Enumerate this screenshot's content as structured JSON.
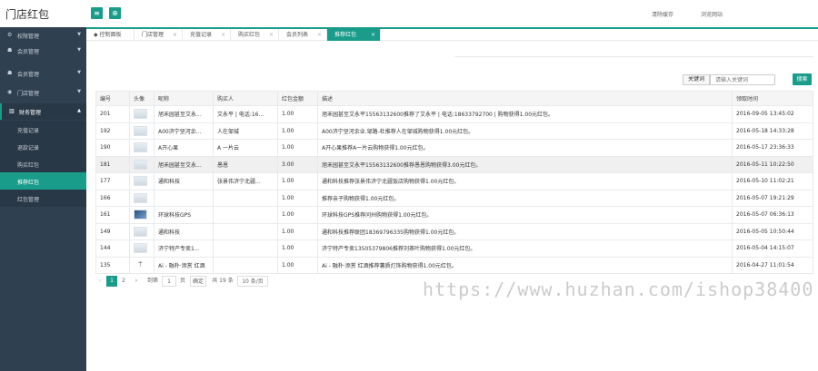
{
  "header": {
    "logo": "门店红包",
    "links": [
      "清除缓存",
      "浏览网站"
    ]
  },
  "sidebar": {
    "items": [
      {
        "label": "权限管理",
        "icon": "gear-icon"
      },
      {
        "label": "会员管理",
        "icon": "users-icon"
      },
      {
        "label": "会员管理",
        "icon": "users-icon"
      },
      {
        "label": "门店管理",
        "icon": "circle-icon"
      },
      {
        "label": "财务管理",
        "icon": "chart-icon"
      }
    ],
    "subitems": [
      "充值记录",
      "退款记录",
      "购买红包",
      "推荐红包",
      "红包管理"
    ]
  },
  "tabs": [
    "控制面板",
    "门店管理",
    "充值记录",
    "购买红包",
    "会员列表",
    "推荐红包"
  ],
  "search": {
    "label": "关键词",
    "placeholder": "请输入关键词",
    "button": "搜索"
  },
  "table": {
    "headers": [
      "编号",
      "头像",
      "昵称",
      "购买人",
      "红包金额",
      "描述",
      "领取时间"
    ],
    "rows": [
      [
        "201",
        "",
        "旭禾园甚至艾永...",
        "艾永平 | 电话:16...",
        "1.00",
        "旭禾园甚至艾永平15563132600推荐了艾永平 | 电话:18633792700 | 购物获得1.00元红包。",
        "2016-09-05 13:45:02"
      ],
      [
        "192",
        "",
        "A00济宁坚河余...",
        "人在邹城",
        "1.00",
        "A00济宁坚河余业.邹路-杜推荐人在邹城购物获得1.00元红包。",
        "2016-05-18 14:33:28"
      ],
      [
        "190",
        "",
        "A开心果",
        "A 一片云",
        "1.00",
        "A开心果推荐A一片云购物获得1.00元红包。",
        "2016-05-17 23:36:33"
      ],
      [
        "181",
        "",
        "旭禾园甚至艾永...",
        "愚恩",
        "3.00",
        "旭禾园甚至艾永平15563132600推荐愚恩购物获得3.00元红包。",
        "2016-05-11 10:22:50"
      ],
      [
        "177",
        "",
        "通和科技",
        "张景伟济宁北疆...",
        "1.00",
        "通和科技推荐张景伟济宁北疆饭店购物获得1.00元红包。",
        "2016-05-10 11:02:21"
      ],
      [
        "166",
        "",
        "",
        "",
        "1.00",
        "推荐亲子购物获得1.00元红包。",
        "2016-05-07 19:21:29"
      ],
      [
        "161",
        "",
        "环球科技GPS",
        "",
        "1.00",
        "环球科技GPS推荐问州购物获得1.00元红包。",
        "2016-05-07 06:36:13"
      ],
      [
        "149",
        "",
        "通和科技",
        "",
        "1.00",
        "通和科技推荐联团18369796335购物获得1.00元红包。",
        "2016-05-05 10:50:44"
      ],
      [
        "144",
        "",
        "济宁特产专卖1...",
        "",
        "1.00",
        "济宁特产专卖13505379806推荐刘茶叶购物获得1.00元红包。",
        "2016-05-04 14:15:07"
      ],
      [
        "135",
        "",
        "Ai - 融朴·添赏 红酒",
        "",
        "1.00",
        "Ai - 融朴·添赏 红酒推荐薯质灯饰购物获得1.00元红包。",
        "2016-04-27 11:01:54"
      ]
    ]
  },
  "pager": {
    "pages": [
      "1",
      "2"
    ],
    "goto_label": "到第",
    "goto_value": "1",
    "page_unit": "页",
    "confirm": "确定",
    "total": "共 19 条",
    "per_page": "10 条/页"
  },
  "watermark": "https://www.huzhan.com/ishop38400",
  "colors": {
    "accent": "#1a9c8b",
    "sidebar": "#2f4050"
  }
}
